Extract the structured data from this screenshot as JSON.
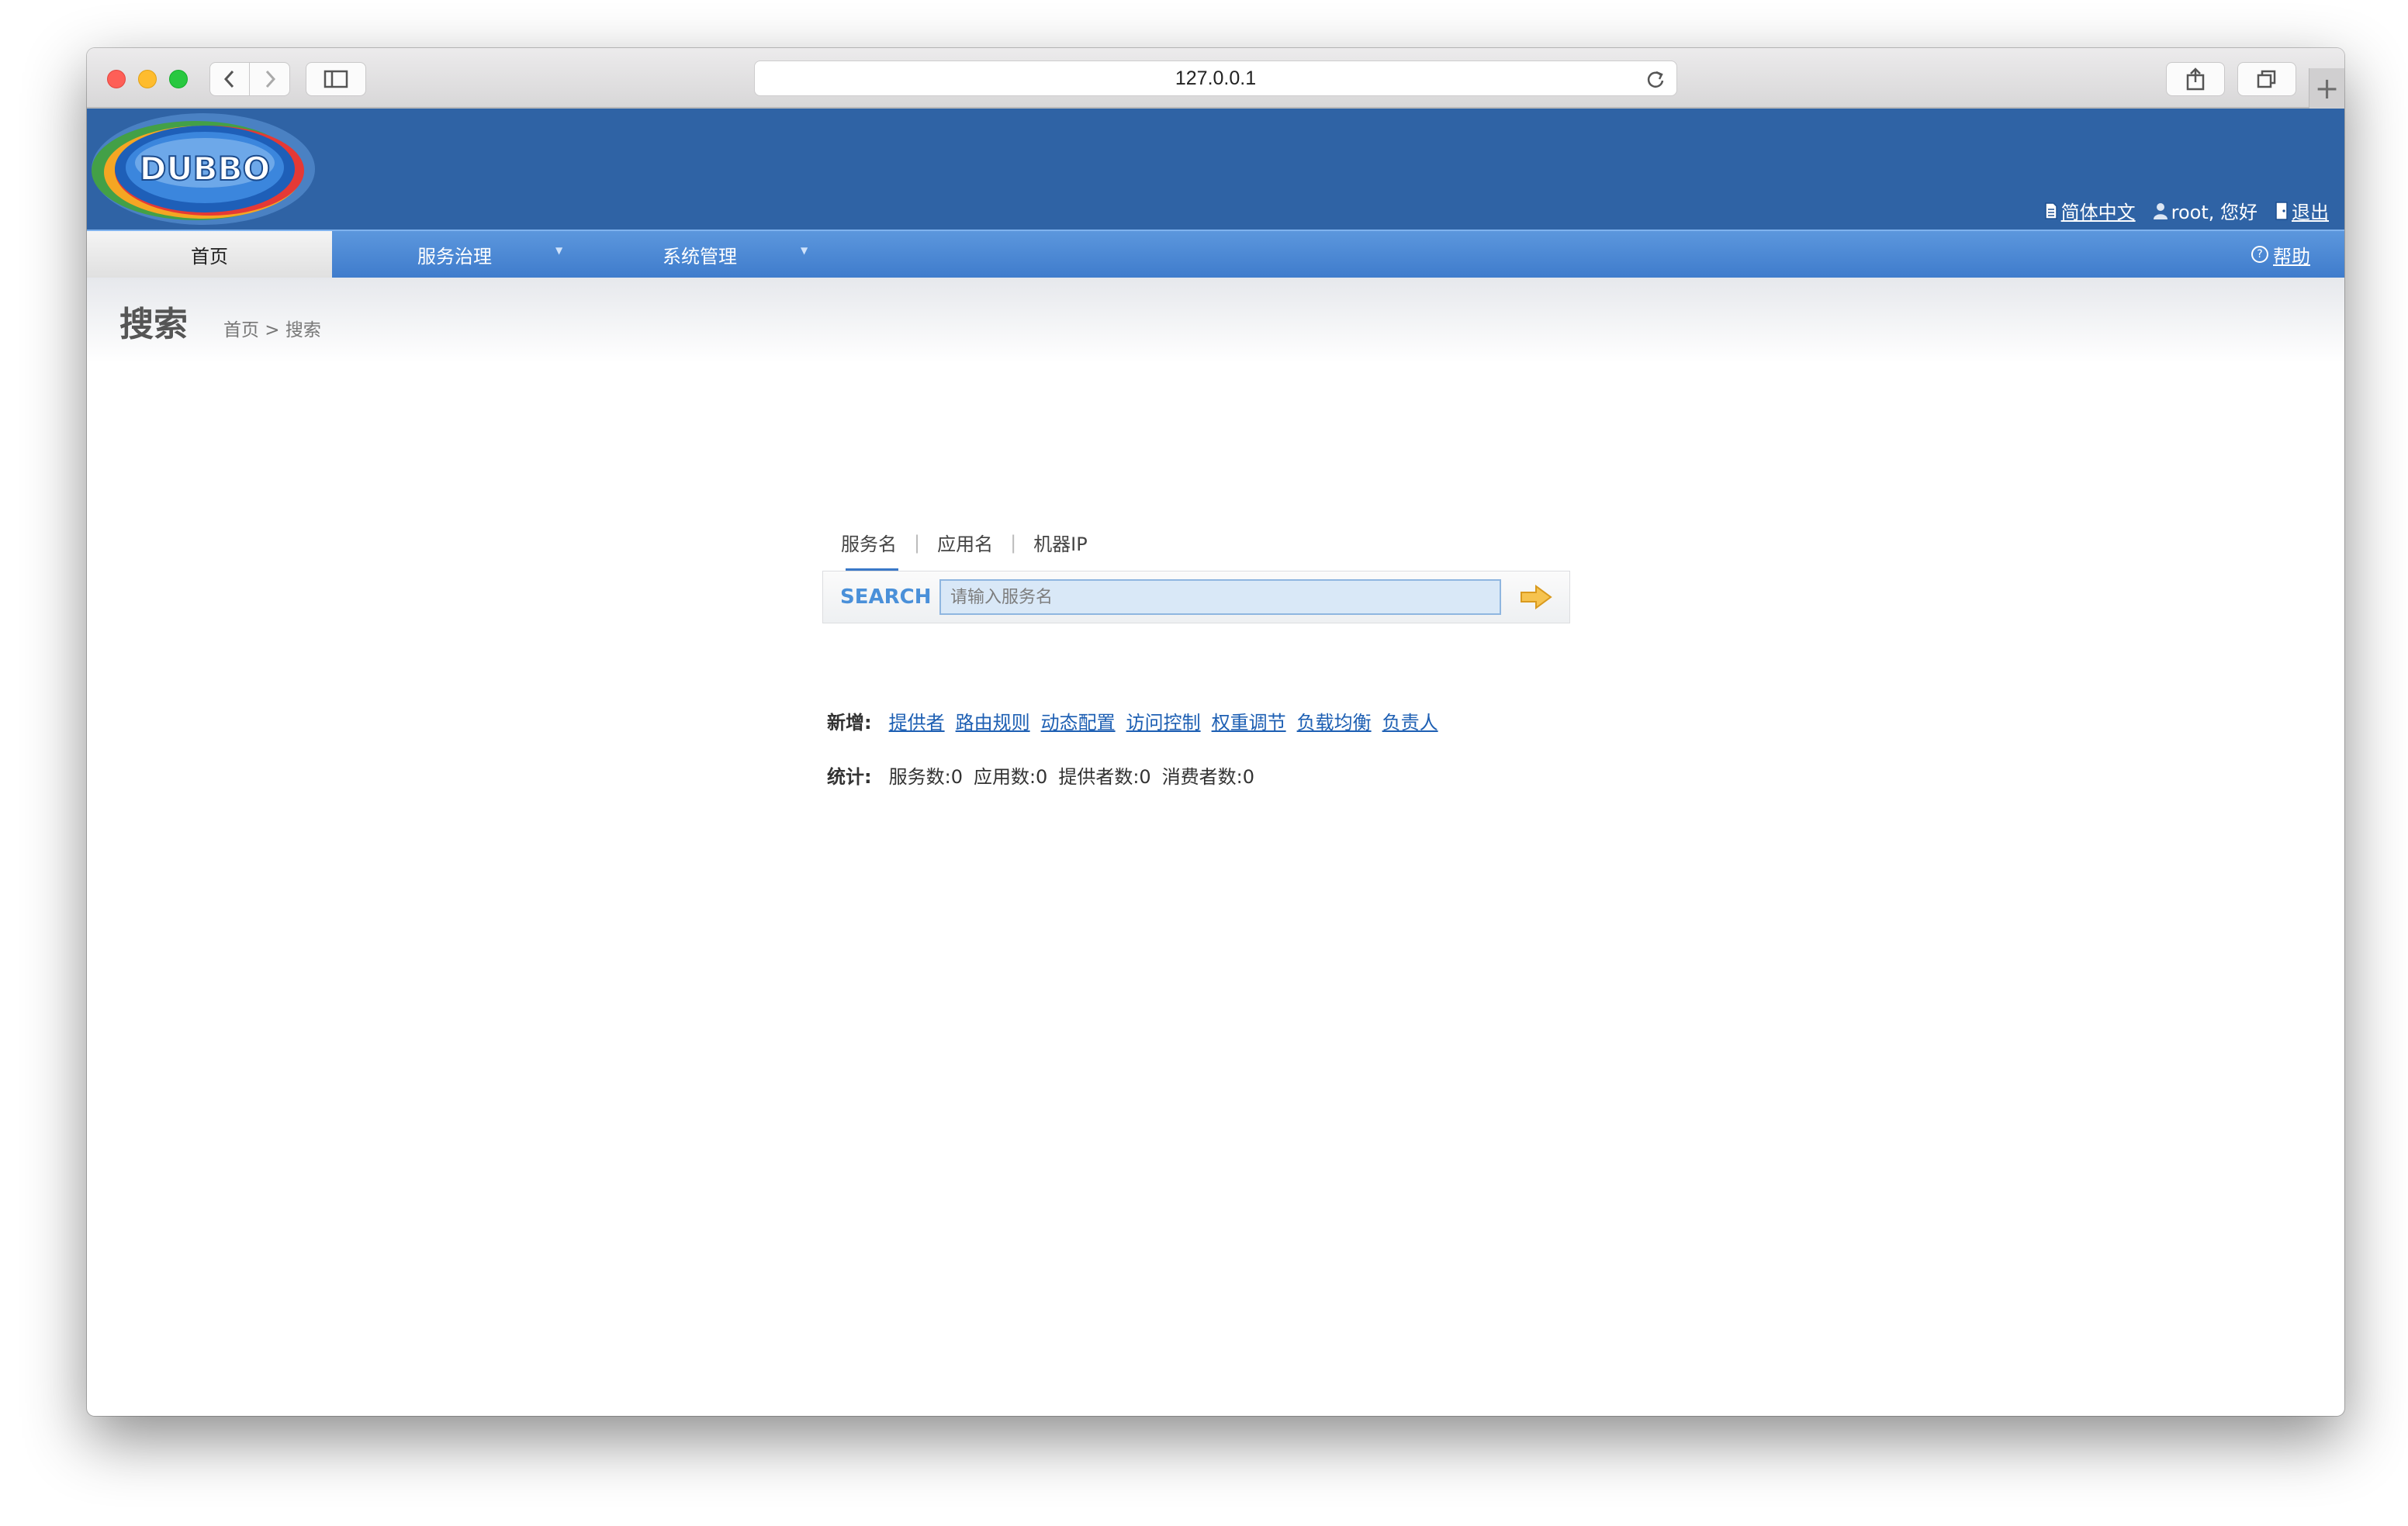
{
  "browser": {
    "url": "127.0.0.1",
    "icons": [
      "back-icon",
      "forward-icon",
      "sidebar-icon",
      "reload-icon",
      "share-icon",
      "tabs-icon",
      "plus-icon"
    ]
  },
  "header": {
    "logo_text": "DUBBO",
    "language_link": "简体中文",
    "greeting": "root, 您好",
    "logout_link": "退出"
  },
  "nav": {
    "home": "首页",
    "service_governance": "服务治理",
    "system_management": "系统管理",
    "help": "帮助"
  },
  "page": {
    "title": "搜索",
    "breadcrumb": "首页 > 搜索"
  },
  "search": {
    "tabs": [
      {
        "label": "服务名",
        "active": true
      },
      {
        "label": "应用名",
        "active": false
      },
      {
        "label": "机器IP",
        "active": false
      }
    ],
    "label": "SEARCH",
    "placeholder": "请输入服务名"
  },
  "add_new": {
    "label": "新增:",
    "links": [
      "提供者",
      "路由规则",
      "动态配置",
      "访问控制",
      "权重调节",
      "负载均衡",
      "负责人"
    ]
  },
  "stats": {
    "label": "统计:",
    "items": [
      "服务数:0",
      "应用数:0",
      "提供者数:0",
      "消费者数:0"
    ]
  },
  "colors": {
    "header_bg": "#2f63a5",
    "nav_bg": "#4a88d6",
    "link": "#1d5fb3",
    "search_label": "#4a90d9",
    "go_arrow": "#f2b53a"
  }
}
